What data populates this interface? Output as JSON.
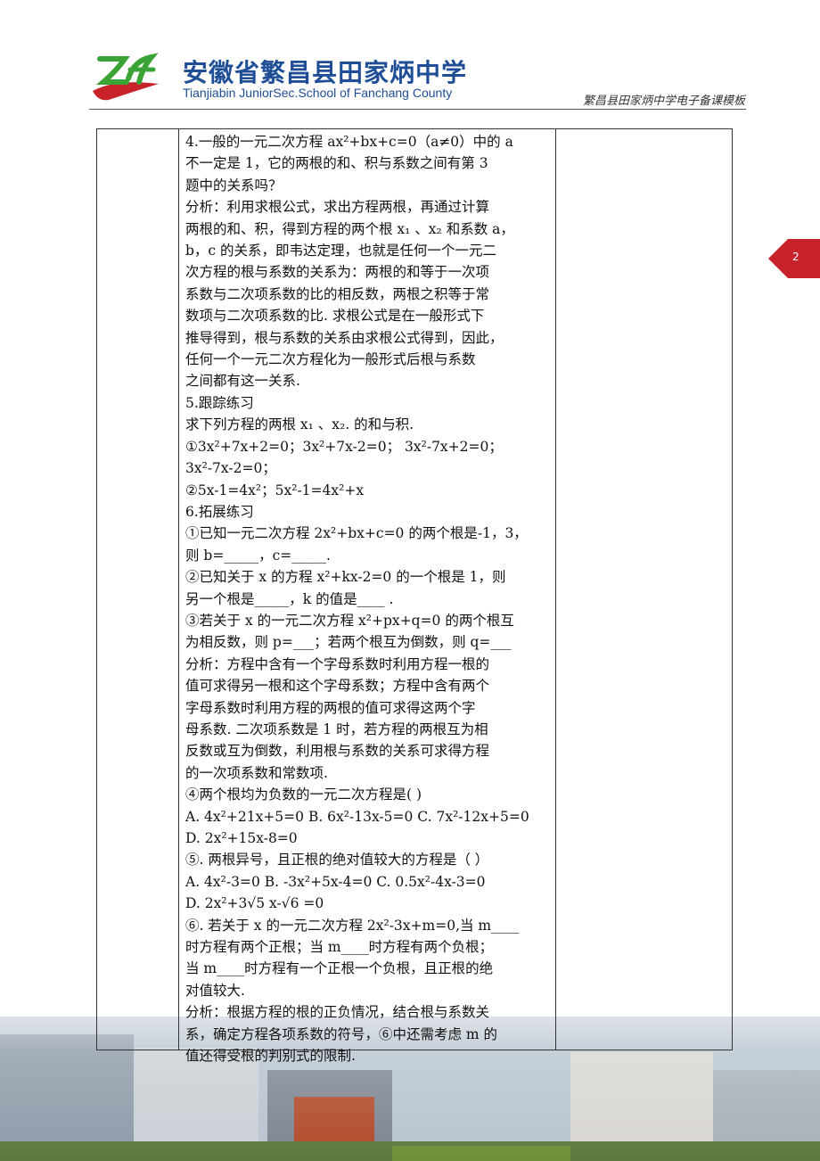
{
  "header": {
    "school_cn": "安徽省繁昌县田家炳中学",
    "school_en": "Tianjiabin JuniorSec.School of Fanchang County",
    "template_label": "繁昌县田家炳中学电子备课模板"
  },
  "page_number": "2",
  "lines": [
    "4.一般的一元二次方程 ax²+bx+c=0（a≠0）中的 a",
    "不一定是 1，它的两根的和、积与系数之间有第 3",
    "题中的关系吗？",
    "分析：利用求根公式，求出方程两根，再通过计算",
    "两根的和、积，得到方程的两个根 x₁ 、x₂ 和系数 a，",
    "b，c 的关系，即韦达定理，也就是任何一个一元二",
    "次方程的根与系数的关系为：两根的和等于一次项",
    "系数与二次项系数的比的相反数，两根之积等于常",
    "数项与二次项系数的比. 求根公式是在一般形式下",
    "推导得到，根与系数的关系由求根公式得到，因此，",
    "任何一个一元二次方程化为一般形式后根与系数",
    "之间都有这一关系.",
    "5.跟踪练习",
    "求下列方程的两根 x₁ 、x₂. 的和与积.",
    "①3x²+7x+2=0；3x²+7x-2=0；  3x²-7x+2=0；",
    "3x²-7x-2=0；",
    "②5x-1=4x²；5x²-1=4x²+x",
    "6.拓展练习",
    "①已知一元二次方程 2x²+bx+c=0 的两个根是-1，3，",
    "则 b=_____，c=_____.",
    "②已知关于 x 的方程 x²+kx-2=0 的一个根是 1，则",
    "另一个根是_____，k 的值是____ .",
    "③若关于 x 的一元二次方程 x²+px+q=0 的两个根互",
    "为相反数，则 p=___；若两个根互为倒数，则 q=___",
    "分析：方程中含有一个字母系数时利用方程一根的",
    "值可求得另一根和这个字母系数；方程中含有两个",
    "字母系数时利用方程的两根的值可求得这两个字",
    "母系数. 二次项系数是 1 时，若方程的两根互为相",
    "反数或互为倒数，利用根与系数的关系可求得方程",
    "的一次项系数和常数项.",
    "④两个根均为负数的一元二次方程是(   )",
    "A. 4x²+21x+5=0   B. 6x²-13x-5=0   C. 7x²-12x+5=0",
    "D. 2x²+15x-8=0",
    "⑤. 两根异号，且正根的绝对值较大的方程是（   ）",
    "A. 4x²-3=0   B. -3x²+5x-4=0   C. 0.5x²-4x-3=0",
    "D. 2x²+3√5 x-√6 =0",
    "⑥. 若关于 x 的一元二次方程 2x²-3x+m=0,当 m____",
    "时方程有两个正根；当 m____时方程有两个负根；",
    "当 m____时方程有一个正根一个负根，且正根的绝",
    "对值较大.",
    "分析：根据方程的根的正负情况，结合根与系数关",
    "系，确定方程各项系数的符号，⑥中还需考虑 m 的",
    "值还得受根的判别式的限制."
  ]
}
